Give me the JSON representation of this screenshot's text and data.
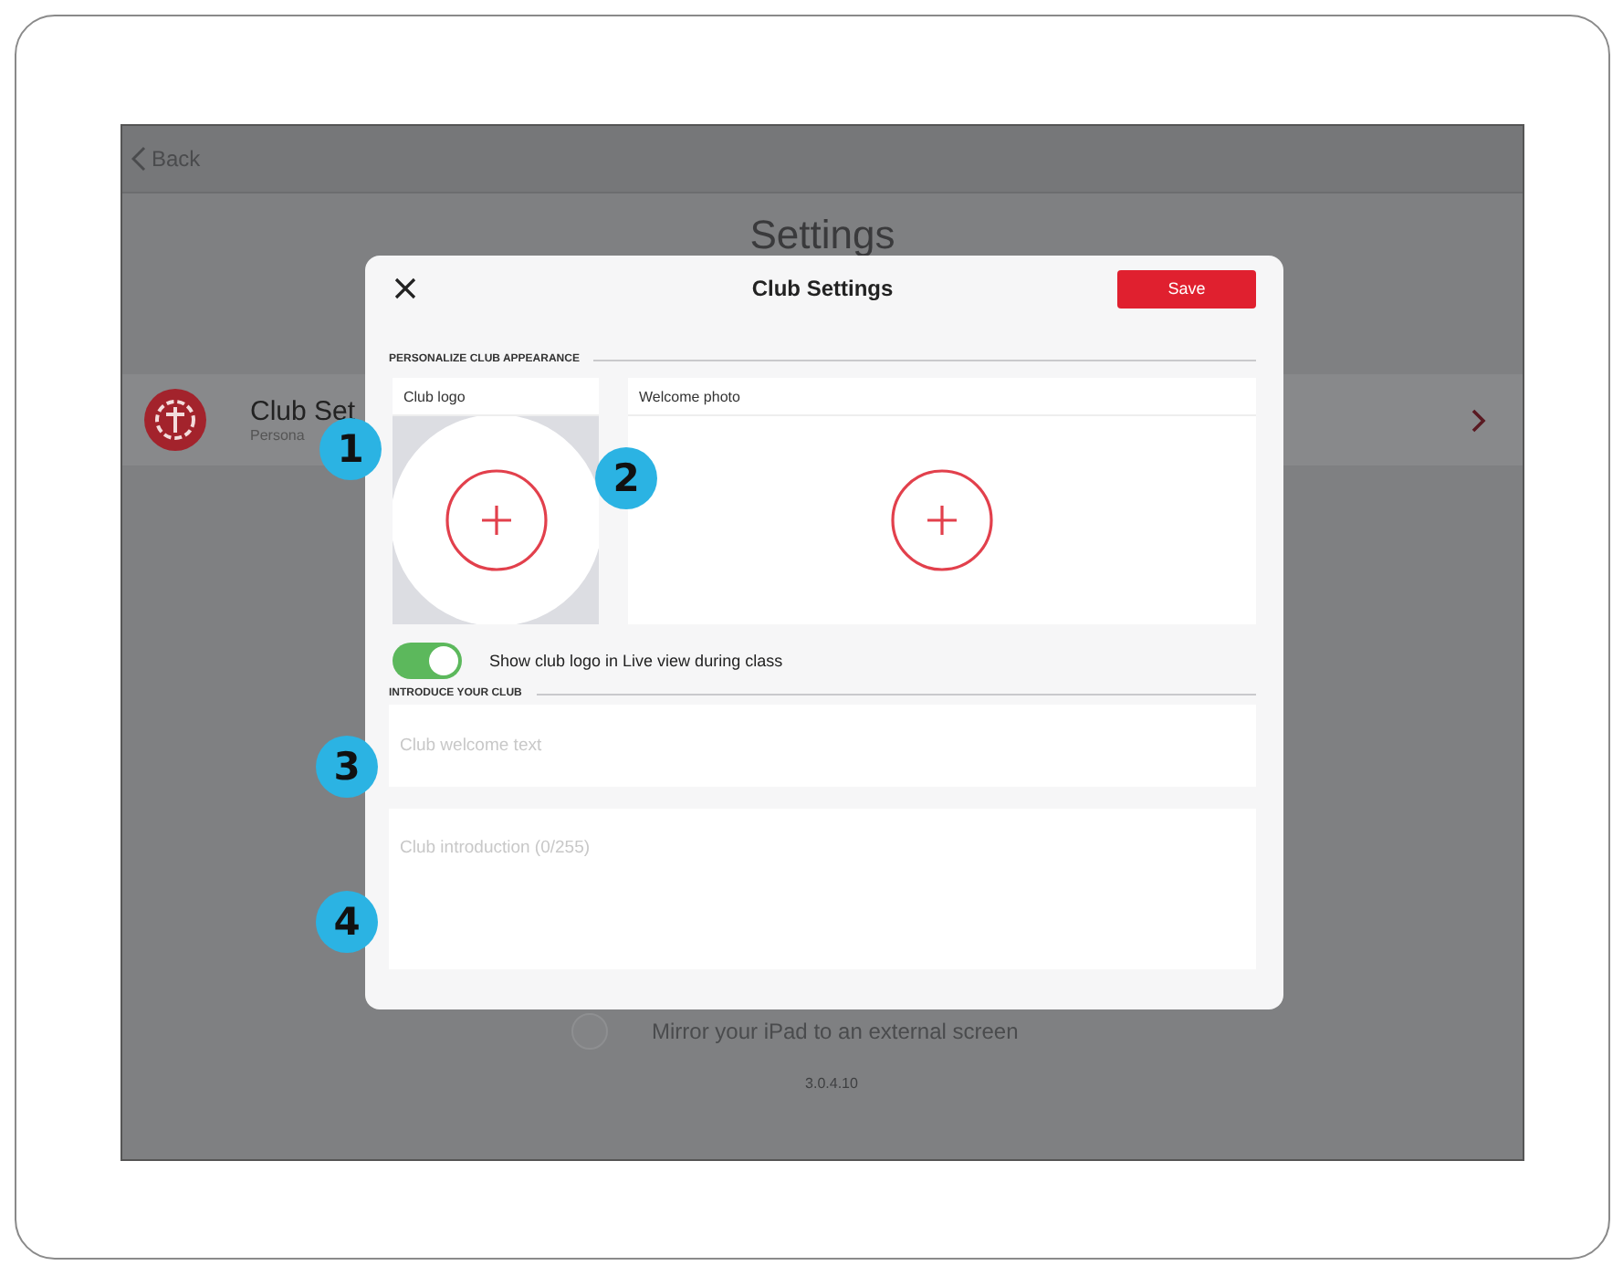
{
  "background": {
    "back_label": "Back",
    "title": "Settings",
    "row": {
      "title": "Club Set",
      "subtitle": "Persona"
    },
    "mirror": {
      "label": "Mirror your iPad to an external screen",
      "checked": false
    },
    "version": "3.0.4.10"
  },
  "modal": {
    "title": "Club Settings",
    "save_label": "Save",
    "appearance_heading": "PERSONALIZE CLUB APPEARANCE",
    "image_slots": [
      {
        "label": "Club logo",
        "kind": "logo"
      },
      {
        "label": "Welcome photo",
        "kind": "photo"
      }
    ],
    "logo_toggle": {
      "label": "Show club logo in Live view during class",
      "on": true
    },
    "intro_heading": "INTRODUCE YOUR CLUB",
    "fields": [
      {
        "placeholder": "Club welcome text",
        "kind": "line"
      },
      {
        "placeholder": "Club introduction (0/255)",
        "kind": "area"
      }
    ]
  },
  "callouts": [
    "1",
    "2",
    "3",
    "4"
  ]
}
